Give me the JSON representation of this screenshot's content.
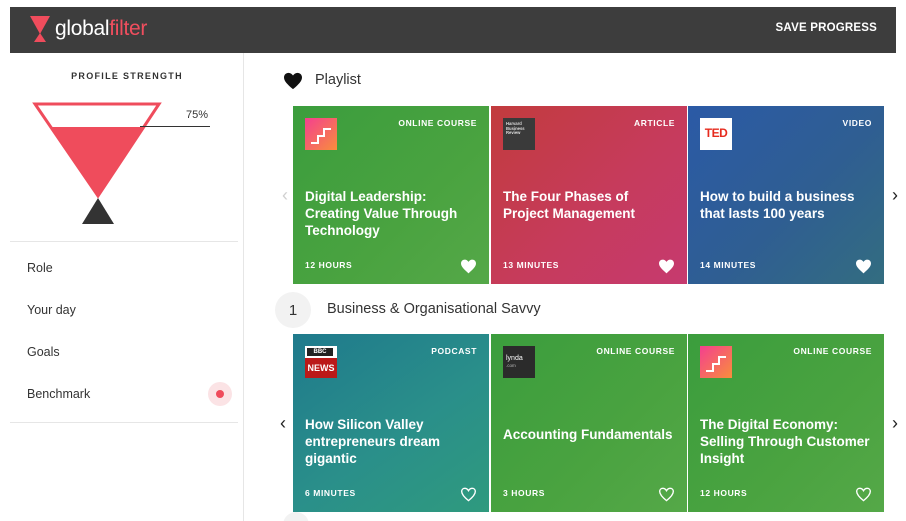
{
  "header": {
    "logo_part1": "global",
    "logo_part2": "filter",
    "save_label": "SAVE PROGRESS"
  },
  "sidebar": {
    "profile_title": "PROFILE STRENGTH",
    "profile_percent_label": "75%",
    "profile_strength": 0.75,
    "nav": [
      "Role",
      "Your day",
      "Goals",
      "Benchmark"
    ]
  },
  "playlist": {
    "title": "Playlist",
    "cards": [
      {
        "type": "ONLINE COURSE",
        "title": "Digital Leadership: Creating Value Through Technology",
        "duration": "12 HOURS",
        "provider_icon": "gradient-stairs-logo",
        "liked": true
      },
      {
        "type": "ARTICLE",
        "title": "The Four Phases of Project Management",
        "duration": "13 MINUTES",
        "provider_icon": "harvard-business-review-logo",
        "provider_text": "Harvard Business Review",
        "liked": true
      },
      {
        "type": "VIDEO",
        "title": "How to build a business that lasts 100 years",
        "duration": "14 MINUTES",
        "provider_icon": "ted-logo",
        "provider_text": "TED",
        "liked": true
      }
    ]
  },
  "section2": {
    "number": "1",
    "title": "Business & Organisational Savvy",
    "cards": [
      {
        "type": "PODCAST",
        "title": "How Silicon Valley entrepreneurs dream gigantic",
        "duration": "6 MINUTES",
        "provider_icon": "bbc-news-logo",
        "provider_text_top": "BBC",
        "provider_text": "NEWS",
        "liked": false
      },
      {
        "type": "ONLINE COURSE",
        "title": "Accounting Fundamentals",
        "duration": "3 HOURS",
        "provider_icon": "lynda-logo",
        "provider_text": "lynda",
        "provider_sub": ".com",
        "liked": false
      },
      {
        "type": "ONLINE COURSE",
        "title": "The Digital Economy: Selling Through Customer Insight",
        "duration": "12 HOURS",
        "provider_icon": "gradient-stairs-logo",
        "liked": false
      }
    ]
  },
  "colors": {
    "topbar": "#3d3d3d",
    "accent": "#ef4c5c",
    "green": "#45a03f",
    "red": "#c43b58",
    "blue": "#2f5e92",
    "teal": "#24848a"
  },
  "icons": {
    "prev": "chevron-left-icon",
    "next": "chevron-right-icon",
    "like_filled": "heart-filled-icon",
    "like_outline": "heart-outline-icon"
  }
}
